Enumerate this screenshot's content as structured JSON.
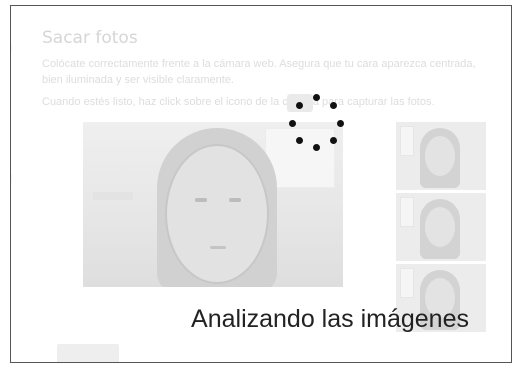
{
  "page": {
    "title": "Sacar fotos",
    "instructions_line1": "Colócate correctamente frente a la cámara web. Asegura que tu cara aparezca centrada,",
    "instructions_line2": "bien iluminada y ser visible claramente.",
    "instructions_line3": "Cuando estés listo, haz click sobre el icono de la cámara para capturar las fotos."
  },
  "overlay": {
    "status": "Analizando las imágenes"
  },
  "icons": {
    "spinner": "loading-spinner-icon",
    "camera": "camera-icon"
  }
}
